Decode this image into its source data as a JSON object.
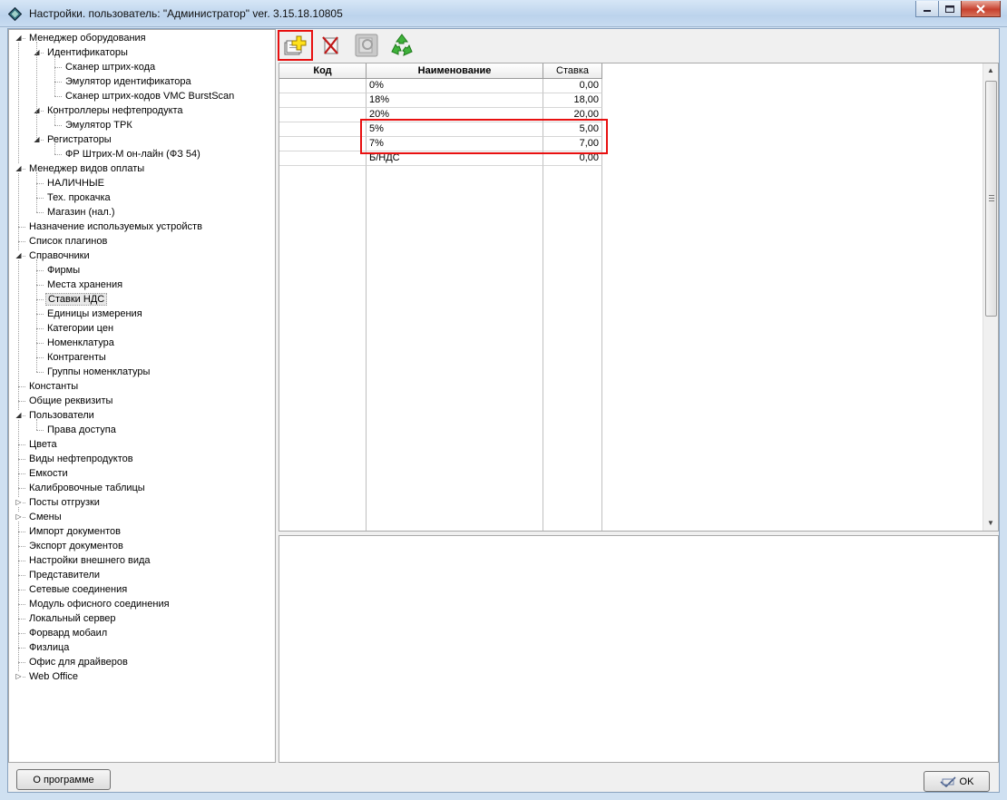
{
  "window": {
    "title": "Настройки. пользователь: \"Администратор\" ver. 3.15.18.10805"
  },
  "tree": [
    {
      "label": "Менеджер оборудования",
      "level": 0,
      "expander": "expanded"
    },
    {
      "label": "Идентификаторы",
      "level": 1,
      "expander": "expanded"
    },
    {
      "label": "Сканер штрих-кода",
      "level": 2,
      "expander": "none"
    },
    {
      "label": "Эмулятор идентификатора",
      "level": 2,
      "expander": "none"
    },
    {
      "label": "Сканер штрих-кодов VMC BurstScan",
      "level": 2,
      "expander": "none"
    },
    {
      "label": "Контроллеры нефтепродукта",
      "level": 1,
      "expander": "expanded"
    },
    {
      "label": "Эмулятор ТРК",
      "level": 2,
      "expander": "none"
    },
    {
      "label": "Регистраторы",
      "level": 1,
      "expander": "expanded"
    },
    {
      "label": "ФР Штрих-М он-лайн (ФЗ 54)",
      "level": 2,
      "expander": "none"
    },
    {
      "label": "Менеджер видов оплаты",
      "level": 0,
      "expander": "expanded"
    },
    {
      "label": "НАЛИЧНЫЕ",
      "level": 1,
      "expander": "none"
    },
    {
      "label": "Тех. прокачка",
      "level": 1,
      "expander": "none"
    },
    {
      "label": "Магазин (нал.)",
      "level": 1,
      "expander": "none"
    },
    {
      "label": "Назначение используемых устройств",
      "level": 0,
      "expander": "none"
    },
    {
      "label": "Список плагинов",
      "level": 0,
      "expander": "none"
    },
    {
      "label": "Справочники",
      "level": 0,
      "expander": "expanded"
    },
    {
      "label": "Фирмы",
      "level": 1,
      "expander": "none"
    },
    {
      "label": "Места хранения",
      "level": 1,
      "expander": "none"
    },
    {
      "label": "Ставки НДС",
      "level": 1,
      "expander": "none",
      "selected": true
    },
    {
      "label": "Единицы измерения",
      "level": 1,
      "expander": "none"
    },
    {
      "label": "Категории цен",
      "level": 1,
      "expander": "none"
    },
    {
      "label": "Номенклатура",
      "level": 1,
      "expander": "none"
    },
    {
      "label": "Контрагенты",
      "level": 1,
      "expander": "none"
    },
    {
      "label": "Группы номенклатуры",
      "level": 1,
      "expander": "none"
    },
    {
      "label": "Константы",
      "level": 0,
      "expander": "none"
    },
    {
      "label": "Общие реквизиты",
      "level": 0,
      "expander": "none"
    },
    {
      "label": "Пользователи",
      "level": 0,
      "expander": "expanded"
    },
    {
      "label": "Права доступа",
      "level": 1,
      "expander": "none"
    },
    {
      "label": "Цвета",
      "level": 0,
      "expander": "none"
    },
    {
      "label": "Виды нефтепродуктов",
      "level": 0,
      "expander": "none"
    },
    {
      "label": "Емкости",
      "level": 0,
      "expander": "none"
    },
    {
      "label": "Калибровочные таблицы",
      "level": 0,
      "expander": "none"
    },
    {
      "label": "Посты отгрузки",
      "level": 0,
      "expander": "collapsed"
    },
    {
      "label": "Смены",
      "level": 0,
      "expander": "collapsed"
    },
    {
      "label": "Импорт документов",
      "level": 0,
      "expander": "none"
    },
    {
      "label": "Экспорт документов",
      "level": 0,
      "expander": "none"
    },
    {
      "label": "Настройки внешнего вида",
      "level": 0,
      "expander": "none"
    },
    {
      "label": "Представители",
      "level": 0,
      "expander": "none"
    },
    {
      "label": "Сетевые соединения",
      "level": 0,
      "expander": "none"
    },
    {
      "label": "Модуль офисного соединения",
      "level": 0,
      "expander": "none"
    },
    {
      "label": "Локальный сервер",
      "level": 0,
      "expander": "none"
    },
    {
      "label": "Форвард мобаил",
      "level": 0,
      "expander": "none"
    },
    {
      "label": "Физлица",
      "level": 0,
      "expander": "none"
    },
    {
      "label": "Офис для драйверов",
      "level": 0,
      "expander": "none"
    },
    {
      "label": "Web Office",
      "level": 0,
      "expander": "collapsed"
    }
  ],
  "toolbar": {
    "buttons": [
      {
        "name": "add-button",
        "icon": "add-record-icon",
        "highlighted": true
      },
      {
        "name": "delete-button",
        "icon": "delete-record-icon"
      },
      {
        "name": "edit-button",
        "icon": "edit-record-icon",
        "disabled": true
      },
      {
        "name": "refresh-button",
        "icon": "recycle-refresh-icon"
      }
    ]
  },
  "grid": {
    "columns": [
      "Код",
      "Наименование",
      "Ставка"
    ],
    "rows": [
      {
        "code": "",
        "name": "0%",
        "rate": "0,00"
      },
      {
        "code": "",
        "name": "18%",
        "rate": "18,00"
      },
      {
        "code": "",
        "name": "20%",
        "rate": "20,00"
      },
      {
        "code": "",
        "name": "5%",
        "rate": "5,00",
        "highlighted": true
      },
      {
        "code": "",
        "name": "7%",
        "rate": "7,00",
        "highlighted": true
      },
      {
        "code": "",
        "name": "Б/НДС",
        "rate": "0,00"
      }
    ]
  },
  "buttons": {
    "about": "О программе",
    "ok": "OK"
  },
  "colors": {
    "highlight": "#e81010",
    "window_frame": "#cfe0f1"
  }
}
